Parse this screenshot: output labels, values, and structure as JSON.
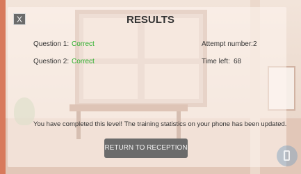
{
  "results": {
    "close_label": "X",
    "title": "RESULTS",
    "questions": [
      {
        "label": "Question 1:",
        "value": "Correct"
      },
      {
        "label": "Question 2:",
        "value": "Correct"
      }
    ],
    "attempt_label": "Attempt number:",
    "attempt_value": "2",
    "time_label": "Time left:",
    "time_value": "68",
    "message": "You have completed this level! The training statistics on your phone has been updated.",
    "return_label": "RETURN TO RECEPTION"
  },
  "colors": {
    "correct": "#2db02d",
    "button_bg": "#6b6b6b",
    "overlay": "rgba(255,245,240,0.55)"
  },
  "icons": {
    "phone": "phone-icon"
  }
}
